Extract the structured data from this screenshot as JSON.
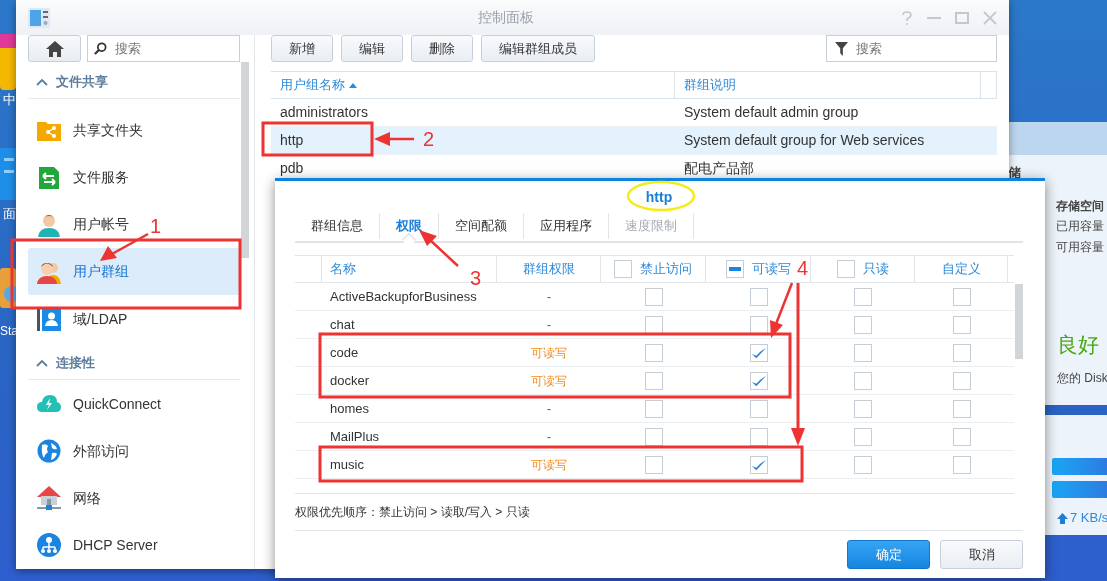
{
  "desktop": {
    "edge_labels": [
      "中",
      "面",
      "Sta"
    ]
  },
  "window": {
    "title": "控制面板"
  },
  "sidebar": {
    "search": {
      "placeholder": "搜索"
    },
    "sections": [
      {
        "title": "文件共享",
        "expanded": true,
        "items": [
          {
            "label": "共享文件夹",
            "kind": "folder",
            "selected": false
          },
          {
            "label": "文件服务",
            "kind": "transfer",
            "selected": false
          },
          {
            "label": "用户帐号",
            "kind": "user",
            "selected": false
          },
          {
            "label": "用户群组",
            "kind": "group",
            "selected": true
          },
          {
            "label": "域/LDAP",
            "kind": "directory",
            "selected": false
          }
        ]
      },
      {
        "title": "连接性",
        "expanded": true,
        "items": [
          {
            "label": "QuickConnect",
            "kind": "cloud",
            "selected": false
          },
          {
            "label": "外部访问",
            "kind": "globe",
            "selected": false
          },
          {
            "label": "网络",
            "kind": "house",
            "selected": false
          },
          {
            "label": "DHCP Server",
            "kind": "network",
            "selected": false
          }
        ]
      }
    ]
  },
  "toolbar": {
    "buttons": [
      "新增",
      "编辑",
      "删除",
      "编辑群组成员"
    ],
    "filter": {
      "placeholder": "搜索"
    }
  },
  "table": {
    "columns": [
      {
        "label": "用户组名称",
        "sorted": true
      },
      {
        "label": "群组说明",
        "sorted": false
      }
    ],
    "rows": [
      {
        "cells": [
          "administrators",
          "System default admin group"
        ],
        "selected": false
      },
      {
        "cells": [
          "http",
          "System default group for Web services"
        ],
        "selected": true
      },
      {
        "cells": [
          "pdb",
          "配电产品部"
        ],
        "selected": false
      }
    ]
  },
  "dialog": {
    "title": "http",
    "tabs": [
      {
        "label": "群组信息",
        "selected": false,
        "disabled": false
      },
      {
        "label": "权限",
        "selected": true,
        "disabled": false
      },
      {
        "label": "空间配额",
        "selected": false,
        "disabled": false
      },
      {
        "label": "应用程序",
        "selected": false,
        "disabled": false
      },
      {
        "label": "速度限制",
        "selected": false,
        "disabled": true
      }
    ],
    "columns": [
      {
        "label": "名称"
      },
      {
        "label": "群组权限"
      },
      {
        "label": "禁止访问",
        "checkbox": {
          "checked": false,
          "indeterminate": false
        }
      },
      {
        "label": "可读写",
        "checkbox": {
          "indeterminate": true
        }
      },
      {
        "label": "只读",
        "checkbox": {
          "checked": false,
          "indeterminate": false
        }
      },
      {
        "label": "自定义"
      }
    ],
    "rows": [
      {
        "name": "ActiveBackupforBusiness",
        "group_permission": "-",
        "granted": false,
        "checks": [
          false,
          false,
          false,
          false
        ]
      },
      {
        "name": "chat",
        "group_permission": "-",
        "granted": false,
        "checks": [
          false,
          false,
          false,
          false
        ]
      },
      {
        "name": "code",
        "group_permission": "可读写",
        "granted": true,
        "checks": [
          false,
          true,
          false,
          false
        ]
      },
      {
        "name": "docker",
        "group_permission": "可读写",
        "granted": true,
        "checks": [
          false,
          true,
          false,
          false
        ]
      },
      {
        "name": "homes",
        "group_permission": "-",
        "granted": false,
        "checks": [
          false,
          false,
          false,
          false
        ]
      },
      {
        "name": "MailPlus",
        "group_permission": "-",
        "granted": false,
        "checks": [
          false,
          false,
          false,
          false
        ]
      },
      {
        "name": "music",
        "group_permission": "可读写",
        "granted": true,
        "checks": [
          false,
          true,
          false,
          false
        ]
      }
    ],
    "note": "权限优先顺序：禁止访问 > 读取/写入 > 只读",
    "buttons": [
      {
        "label": "确定",
        "kind": "primary"
      },
      {
        "label": "取消",
        "kind": "secondary"
      }
    ]
  },
  "widgets": {
    "heading_fragment": "储",
    "storage": {
      "title": "存储空间",
      "lines": [
        "已用容量",
        "可用容量"
      ]
    },
    "health": {
      "status": "良好",
      "message": "您的 Disk"
    },
    "network": {
      "speed": "7 KB/s"
    }
  },
  "annotations": {
    "numbers": [
      "1",
      "2",
      "3",
      "4"
    ]
  }
}
